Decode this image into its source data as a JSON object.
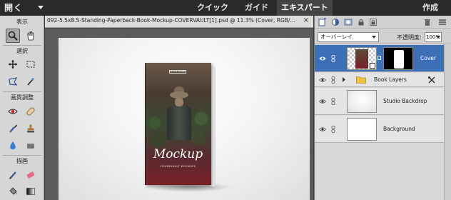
{
  "menubar": {
    "open_label": "開く",
    "tabs": [
      {
        "label": "クイック",
        "active": false
      },
      {
        "label": "ガイド",
        "active": false
      },
      {
        "label": "エキスパート",
        "active": true
      }
    ],
    "create_label": "作成"
  },
  "toolbox": {
    "sections": [
      "表示",
      "選択",
      "画質調整",
      "描画"
    ],
    "tools": {
      "zoom": "zoom-icon",
      "hand": "hand-icon",
      "move": "move-icon",
      "marquee": "marquee-icon",
      "lasso": "lasso-icon",
      "magic_wand": "magic-wand-icon",
      "red_eye": "red-eye-icon",
      "spot_heal": "spot-healing-icon",
      "smart_brush": "smart-brush-icon",
      "clone_stamp": "clone-stamp-icon",
      "blur": "blur-icon",
      "sponge": "sponge-icon",
      "brush": "brush-icon",
      "eraser": "eraser-icon",
      "paint_bucket": "paint-bucket-icon",
      "gradient": "gradient-icon"
    }
  },
  "document": {
    "tab_title": "092-5.5x8.5-Standing-Paperback-Book-Mockup-COVERVAULT[1].psd @ 11.3% (Cover, RGB/...",
    "close_symbol": "×"
  },
  "book": {
    "brand_text": "IN THE WORD",
    "title": "Mockup",
    "subtitle": "COVERVAULT MOCKUPS"
  },
  "layers_panel": {
    "blend_mode": "オーバーレイ",
    "opacity_label": "不透明度:",
    "opacity_value": "100%",
    "layers": [
      {
        "name": "Cover",
        "active": true,
        "type": "smart-object-with-mask"
      },
      {
        "name": "Book Layers",
        "active": false,
        "type": "group"
      },
      {
        "name": "Studio Backdrop",
        "active": false,
        "type": "image"
      },
      {
        "name": "Background",
        "active": false,
        "type": "image"
      }
    ]
  },
  "colors": {
    "menubar_bg": "#2a2a2a",
    "active_layer": "#3d6fb6",
    "panel_bg": "#d8d8d8",
    "toolbox_bg": "#d6d6d6"
  }
}
